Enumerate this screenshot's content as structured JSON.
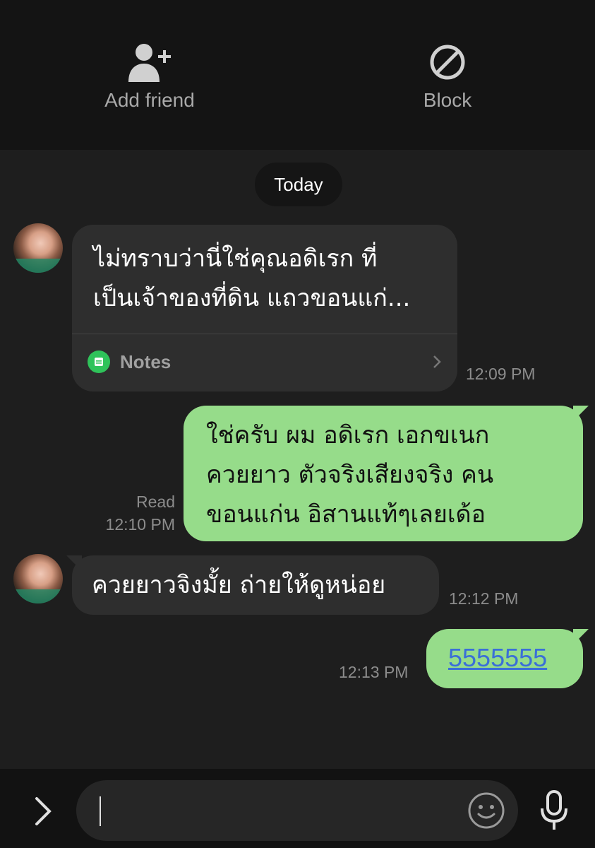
{
  "header": {
    "add_friend_label": "Add friend",
    "block_label": "Block"
  },
  "chat": {
    "date_divider": "Today",
    "messages": [
      {
        "direction": "incoming",
        "text": "ไม่ทราบว่านี่ใช่คุณอดิเรก ที่\nเป็นเจ้าของที่ดิน แถวขอนแก่...",
        "attachment_label": "Notes",
        "time": "12:09 PM"
      },
      {
        "direction": "outgoing",
        "text": "ใช่ครับ ผม อดิเรก เอกขเนก\nควยยาว ตัวจริงเสียงจริง คน\nขอนแก่น อิสานแท้ๆเลยเด้อ",
        "read_label": "Read",
        "time": "12:10 PM"
      },
      {
        "direction": "incoming",
        "text": "ควยยาวจิงมั้ย ถ่ายให้ดูหน่อย",
        "time": "12:12 PM"
      },
      {
        "direction": "outgoing",
        "text": "5555555",
        "time": "12:13 PM"
      }
    ]
  },
  "input": {
    "value": "",
    "placeholder": ""
  },
  "colors": {
    "outgoing_bubble": "#96dc8a",
    "incoming_bubble": "#2e2e2e",
    "link": "#3a6fd8",
    "notes_icon": "#2fc35a"
  }
}
